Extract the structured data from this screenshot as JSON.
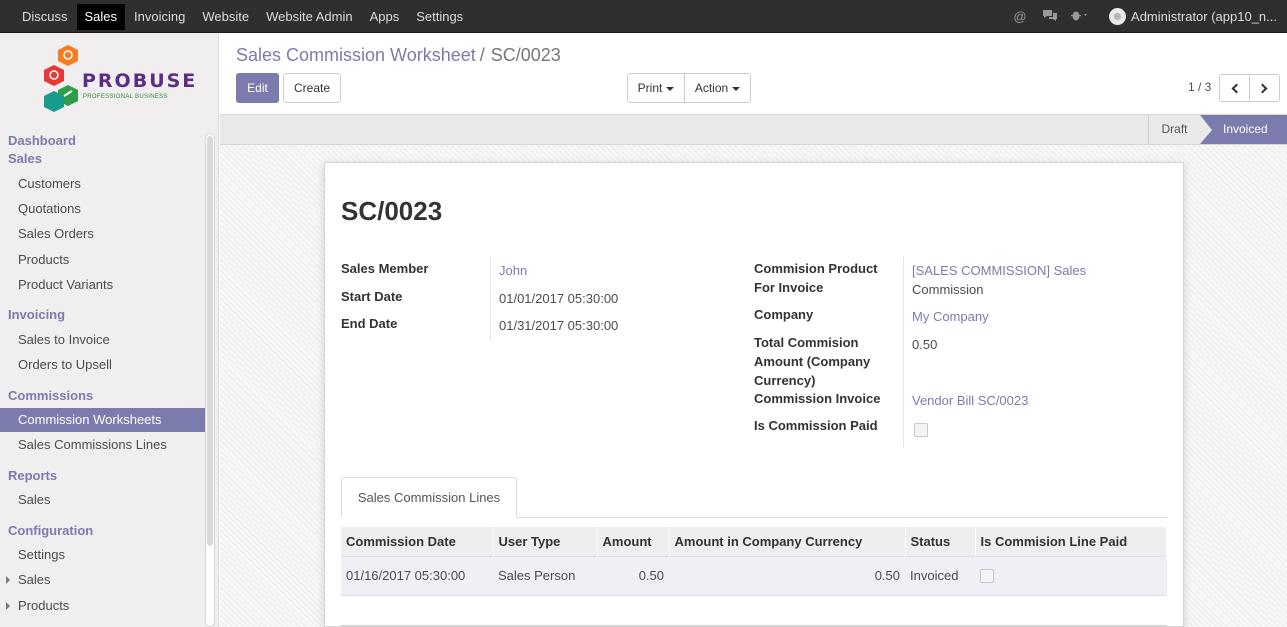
{
  "topbar": {
    "menu": [
      "Discuss",
      "Sales",
      "Invoicing",
      "Website",
      "Website Admin",
      "Apps",
      "Settings"
    ],
    "active_menu": "Sales",
    "user": "Administrator (app10_n..."
  },
  "logo": {
    "brand": "PROBUSE",
    "tagline": "PROFESSIONAL BUSINESS"
  },
  "sidebar": {
    "dashboard": "Dashboard",
    "sales_section": "Sales",
    "sales_items": [
      "Customers",
      "Quotations",
      "Sales Orders",
      "Products",
      "Product Variants"
    ],
    "invoicing_section": "Invoicing",
    "invoicing_items": [
      "Sales to Invoice",
      "Orders to Upsell"
    ],
    "commissions_section": "Commissions",
    "commissions_items": [
      "Commission Worksheets",
      "Sales Commissions Lines"
    ],
    "reports_section": "Reports",
    "reports_items": [
      "Sales"
    ],
    "configuration_section": "Configuration",
    "configuration_items": [
      "Settings",
      "Sales",
      "Products"
    ]
  },
  "breadcrumb": {
    "parent": "Sales Commission Worksheet",
    "separator": "/",
    "current": "SC/0023"
  },
  "buttons": {
    "edit": "Edit",
    "create": "Create",
    "print": "Print",
    "action": "Action"
  },
  "pager": {
    "text": "1 / 3"
  },
  "stages": {
    "draft": "Draft",
    "invoiced": "Invoiced",
    "active": "Invoiced"
  },
  "form": {
    "title": "SC/0023",
    "left": {
      "sales_member_label": "Sales Member",
      "sales_member": "John",
      "start_date_label": "Start Date",
      "start_date": "01/01/2017 05:30:00",
      "end_date_label": "End Date",
      "end_date": "01/31/2017 05:30:00"
    },
    "right": {
      "product_label_1": "Commision Product",
      "product_label_2": "For Invoice",
      "product_1": "[SALES COMMISSION] Sales",
      "product_2": "Commission",
      "company_label": "Company",
      "company": "My Company",
      "total_label_1": "Total Commision",
      "total_label_2": "Amount (Company",
      "total_label_3": "Currency)",
      "total": "0.50",
      "invoice_label": "Commission Invoice",
      "invoice": "Vendor Bill SC/0023",
      "paid_label": "Is Commission Paid",
      "paid": false
    },
    "tab": "Sales Commission Lines",
    "lines": {
      "headers": [
        "Commission Date",
        "User Type",
        "Amount",
        "Amount in Company Currency",
        "Status",
        "Is Commision Line Paid"
      ],
      "rows": [
        {
          "date": "01/16/2017 05:30:00",
          "user_type": "Sales Person",
          "amount": "0.50",
          "amount_company": "0.50",
          "status": "Invoiced",
          "paid": false
        }
      ]
    }
  },
  "colors": {
    "accent": "#7c7bad",
    "topbar": "#2f2f2f",
    "sidebar": "#f0eeee"
  }
}
